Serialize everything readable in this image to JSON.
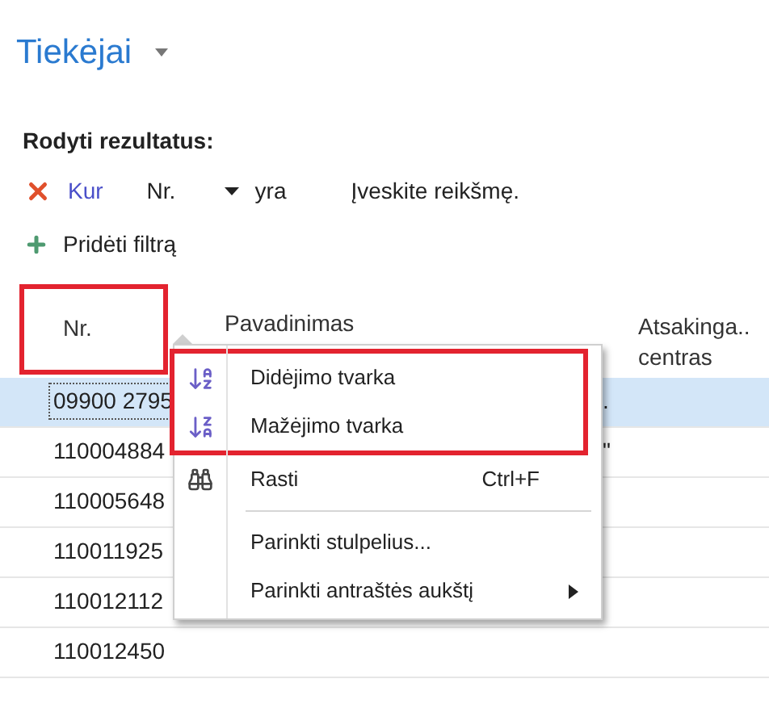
{
  "page": {
    "title": "Tiekėjai"
  },
  "filter": {
    "heading": "Rodyti rezultatus:",
    "rule": {
      "keyword": "Kur",
      "field": "Nr.",
      "operator": "yra",
      "placeholder": "Įveskite reikšmę."
    },
    "add_filter": "Pridėti filtrą"
  },
  "table": {
    "columns": [
      {
        "label": "Nr.",
        "highlighted": true
      },
      {
        "label": "Pavadinimas",
        "highlighted": false
      },
      {
        "label": "Atsakinga..\ncentras",
        "highlighted": false
      }
    ],
    "rows": [
      {
        "number": "09900 2795",
        "column_2": ".",
        "selected": true
      },
      {
        "number": "110004884",
        "column_2": "\"",
        "selected": false
      },
      {
        "number": "110005648",
        "selected": false
      },
      {
        "number": "110011925",
        "selected": false
      },
      {
        "number": "110012112",
        "selected": false
      },
      {
        "number": "110012450",
        "selected": false
      }
    ]
  },
  "context_menu": {
    "items": [
      {
        "kind": "sort_asc",
        "label": "Didėjimo tvarka",
        "highlighted": true
      },
      {
        "kind": "sort_desc",
        "label": "Mažėjimo tvarka",
        "highlighted": true
      },
      {
        "kind": "find",
        "label": "Rasti",
        "shortcut": "Ctrl+F",
        "highlighted": false
      },
      {
        "kind": "separator"
      },
      {
        "kind": "plain",
        "label": "Parinkti stulpelius...",
        "highlighted": false
      },
      {
        "kind": "submenu",
        "label": "Parinkti antraštės aukštį",
        "highlighted": false
      }
    ]
  }
}
